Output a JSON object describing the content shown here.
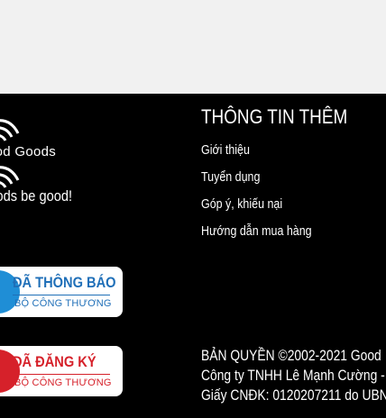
{
  "footer": {
    "brand": {
      "wordmark": "Good Goods",
      "tagline": "Goods be good!"
    },
    "badges": [
      {
        "title": "ĐÃ THÔNG BÁO",
        "subtitle": "BỘ CÔNG THƯƠNG",
        "color": "#1f6fb8"
      },
      {
        "title": "ĐÃ ĐĂNG KÝ",
        "subtitle": "BỘ CÔNG THƯƠNG",
        "color": "#d6212a"
      }
    ],
    "info": {
      "heading": "THÔNG TIN THÊM",
      "links": [
        "Giới thiệu",
        "Tuyển dụng",
        "Góp ý, khiếu nại",
        "Hướng dẫn mua hàng"
      ]
    },
    "copyright": {
      "line1": "BẢN QUYỀN ©2002-2021 Good",
      "line2": "Công ty TNHH Lê Mạnh Cường -",
      "line3": "Giấy CNĐK: 0120207211 do UBN"
    }
  },
  "colors": {
    "footer_bg": "#000000",
    "page_bg": "#f1f1f1"
  }
}
